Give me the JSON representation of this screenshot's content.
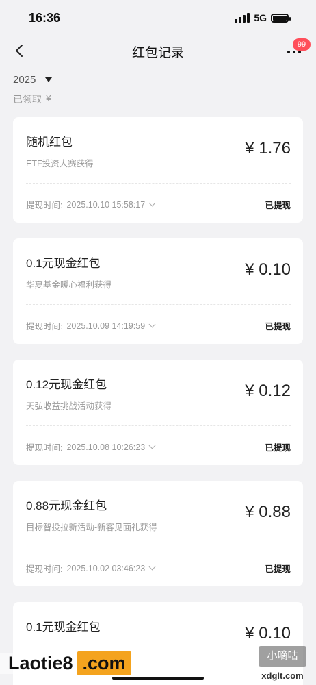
{
  "status": {
    "time": "16:36",
    "network": "5G"
  },
  "nav": {
    "title": "红包记录",
    "badge": "99"
  },
  "filter": {
    "year": "2025",
    "received_label": "已领取",
    "received_value": "¥"
  },
  "records": [
    {
      "title": "随机红包",
      "source": "ETF投资大赛获得",
      "amount": "¥ 1.76",
      "time_label": "提现时间:",
      "time": "2025.10.10 15:58:17",
      "status": "已提现"
    },
    {
      "title": "0.1元现金红包",
      "source": "华夏基金暖心福利获得",
      "amount": "¥ 0.10",
      "time_label": "提现时间:",
      "time": "2025.10.09 14:19:59",
      "status": "已提现"
    },
    {
      "title": "0.12元现金红包",
      "source": "天弘收益挑战活动获得",
      "amount": "¥ 0.12",
      "time_label": "提现时间:",
      "time": "2025.10.08 10:26:23",
      "status": "已提现"
    },
    {
      "title": "0.88元现金红包",
      "source": "目标智投拉新活动-新客见面礼获得",
      "amount": "¥ 0.88",
      "time_label": "提现时间:",
      "time": "2025.10.02 03:46:23",
      "status": "已提现"
    },
    {
      "title": "0.1元现金红包",
      "source": "",
      "amount": "¥ 0.10",
      "time_label": "",
      "time": "",
      "status": ""
    }
  ],
  "watermark": {
    "left_text": "Laotie8",
    "left_box": ".com",
    "right_box": "小嘀咕",
    "right_url": "xdglt.com"
  }
}
